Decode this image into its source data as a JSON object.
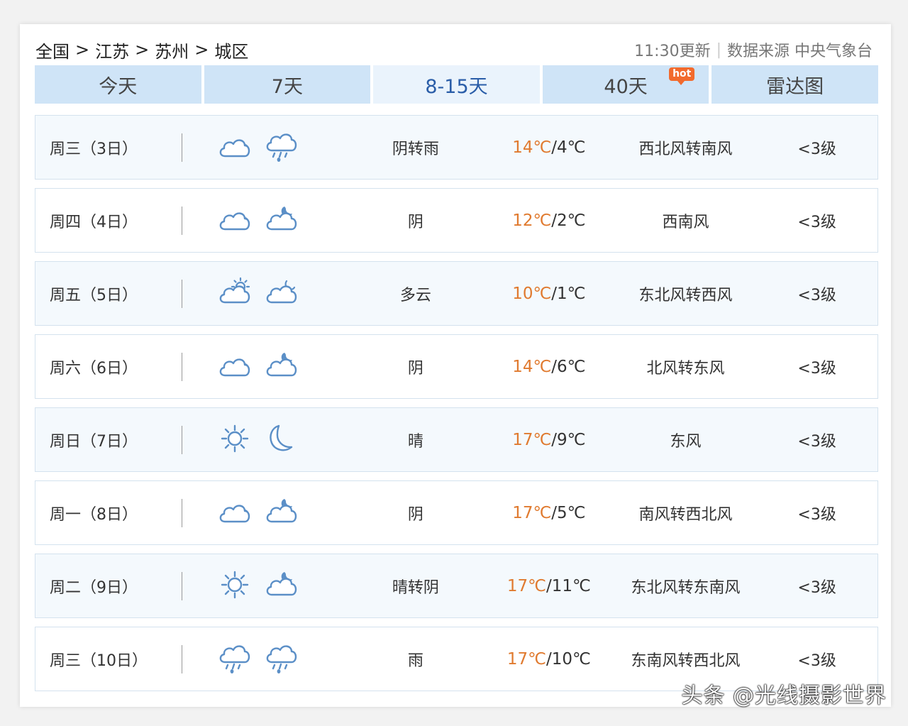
{
  "breadcrumb": [
    "全国",
    "江苏",
    "苏州",
    "城区"
  ],
  "breadcrumb_separator": ">",
  "meta": {
    "updated": "11:30更新",
    "divider": "|",
    "source": "数据来源 中央气象台"
  },
  "tabs": [
    {
      "label": "今天"
    },
    {
      "label": "7天"
    },
    {
      "label": "8-15天"
    },
    {
      "label": "40天",
      "badge": "hot"
    },
    {
      "label": "雷达图"
    }
  ],
  "active_tab": "8-15天",
  "colors": {
    "high_temp": "#e07a2f",
    "icon_stroke": "#5b8fc7",
    "tab_bg": "#cfe4f7",
    "active_tab_text": "#2a5da8"
  },
  "rows": [
    {
      "day": "周三（3日）",
      "icons": [
        "cloud-icon",
        "rain-icon"
      ],
      "desc": "阴转雨",
      "high": "14℃",
      "low": "/4℃",
      "wind": "西北风转南风",
      "level": "<3级"
    },
    {
      "day": "周四（4日）",
      "icons": [
        "cloud-icon",
        "cloudy-night-icon"
      ],
      "desc": "阴",
      "high": "12℃",
      "low": "/2℃",
      "wind": "西南风",
      "level": "<3级"
    },
    {
      "day": "周五（5日）",
      "icons": [
        "partly-cloudy-day-icon",
        "partly-cloudy-night-icon"
      ],
      "desc": "多云",
      "high": "10℃",
      "low": "/1℃",
      "wind": "东北风转西风",
      "level": "<3级"
    },
    {
      "day": "周六（6日）",
      "icons": [
        "cloud-icon",
        "cloudy-night-icon"
      ],
      "desc": "阴",
      "high": "14℃",
      "low": "/6℃",
      "wind": "北风转东风",
      "level": "<3级"
    },
    {
      "day": "周日（7日）",
      "icons": [
        "sun-icon",
        "moon-icon"
      ],
      "desc": "晴",
      "high": "17℃",
      "low": "/9℃",
      "wind": "东风",
      "level": "<3级"
    },
    {
      "day": "周一（8日）",
      "icons": [
        "cloud-icon",
        "cloudy-night-icon"
      ],
      "desc": "阴",
      "high": "17℃",
      "low": "/5℃",
      "wind": "南风转西北风",
      "level": "<3级"
    },
    {
      "day": "周二（9日）",
      "icons": [
        "sun-icon",
        "cloudy-night-icon"
      ],
      "desc": "晴转阴",
      "high": "17℃",
      "low": "/11℃",
      "wind": "东北风转东南风",
      "level": "<3级"
    },
    {
      "day": "周三（10日）",
      "icons": [
        "rain-icon",
        "rain-icon"
      ],
      "desc": "雨",
      "high": "17℃",
      "low": "/10℃",
      "wind": "东南风转西北风",
      "level": "<3级"
    }
  ],
  "watermark": "头条 @光线摄影世界"
}
